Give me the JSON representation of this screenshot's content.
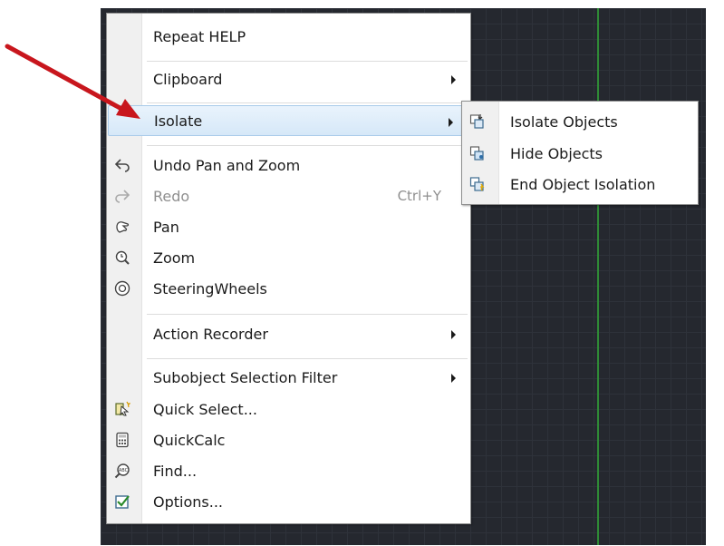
{
  "menu": {
    "items": [
      {
        "label": "Repeat HELP"
      },
      {
        "label": "Clipboard"
      },
      {
        "label": "Isolate"
      },
      {
        "label": "Undo Pan and Zoom",
        "icon": "undo-icon"
      },
      {
        "label": "Redo",
        "shortcut": "Ctrl+Y",
        "icon": "redo-icon",
        "disabled": true
      },
      {
        "label": "Pan",
        "icon": "pan-hand-icon"
      },
      {
        "label": "Zoom",
        "icon": "zoom-icon"
      },
      {
        "label": "SteeringWheels",
        "icon": "steering-wheel-icon"
      },
      {
        "label": "Action Recorder"
      },
      {
        "label": "Subobject Selection Filter"
      },
      {
        "label": "Quick Select...",
        "icon": "quick-select-icon"
      },
      {
        "label": "QuickCalc",
        "icon": "calculator-icon"
      },
      {
        "label": "Find...",
        "icon": "find-icon"
      },
      {
        "label": "Options...",
        "icon": "options-checkbox-icon"
      }
    ]
  },
  "submenu": {
    "items": [
      {
        "label": "Isolate Objects",
        "icon": "isolate-objects-icon"
      },
      {
        "label": "Hide Objects",
        "icon": "hide-objects-icon"
      },
      {
        "label": "End Object Isolation",
        "icon": "end-isolation-icon"
      }
    ]
  },
  "colors": {
    "canvas": "#25282f",
    "highlight": "#d6e8f8",
    "annotation_arrow": "#c8161d",
    "axis": "#2f8a36"
  }
}
